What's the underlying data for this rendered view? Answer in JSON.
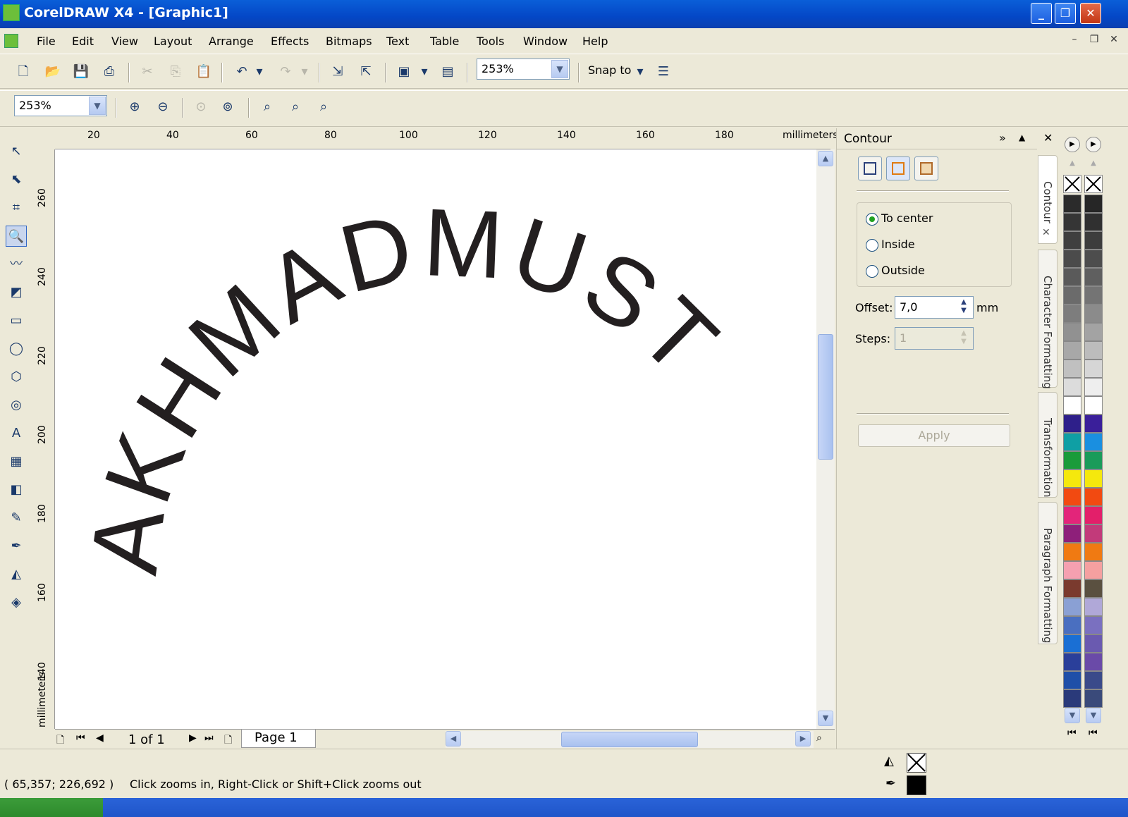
{
  "window": {
    "title": "CorelDRAW X4 - [Graphic1]"
  },
  "menu": [
    "File",
    "Edit",
    "View",
    "Layout",
    "Arrange",
    "Effects",
    "Bitmaps",
    "Text",
    "Table",
    "Tools",
    "Window",
    "Help"
  ],
  "toolbar": {
    "zoom_value": "253%",
    "snap_label": "Snap to"
  },
  "property_bar": {
    "zoom_value": "253%"
  },
  "ruler": {
    "top_labels": [
      "20",
      "40",
      "60",
      "80",
      "100",
      "120",
      "140",
      "160",
      "180"
    ],
    "units": "millimeters",
    "left_labels": [
      "260",
      "240",
      "220",
      "200",
      "180",
      "160",
      "140"
    ],
    "left_units": "millimeters"
  },
  "canvas": {
    "artistic_text": "AKHMADMUST"
  },
  "page_nav": {
    "counter": "1 of 1",
    "page_tab": "Page 1"
  },
  "docker": {
    "title": "Contour",
    "options": [
      {
        "label": "To center",
        "selected": true
      },
      {
        "label": "Inside",
        "selected": false
      },
      {
        "label": "Outside",
        "selected": false
      }
    ],
    "offset_label": "Offset:",
    "offset_value": "7,0",
    "offset_unit": "mm",
    "steps_label": "Steps:",
    "steps_value": "1",
    "apply_label": "Apply"
  },
  "docker_tabs": [
    "Contour",
    "Character Formatting",
    "Transformation",
    "Paragraph Formatting"
  ],
  "palette_colors_1": [
    "#2b2b2b",
    "#353535",
    "#3f3f3f",
    "#4b4b4b",
    "#5a5a5a",
    "#6b6b6b",
    "#7d7d7d",
    "#919191",
    "#a8a8a8",
    "#c0c0c0",
    "#dcdcdc",
    "#ffffff",
    "#2e1f8a",
    "#0f9fa4",
    "#1a9b3a",
    "#f5e80d",
    "#f24a11",
    "#e3257a",
    "#8e1f7a",
    "#f07a12",
    "#f5a0b0",
    "#7a3a2e",
    "#8aa0d4",
    "#4a6fc0",
    "#1a6fd4",
    "#2a3f9a",
    "#1f4fa8",
    "#2a3a7a",
    "#1f2f6a"
  ],
  "palette_colors_2": [
    "#262626",
    "#303030",
    "#3d3d3d",
    "#4d4d4d",
    "#5f5f5f",
    "#747474",
    "#8b8b8b",
    "#a3a3a3",
    "#bcbcbc",
    "#d6d6d6",
    "#eeeeee",
    "#ffffff",
    "#3a1f9a",
    "#1a8fe0",
    "#1a9b5a",
    "#f5e80d",
    "#f24a11",
    "#e31f6a",
    "#c23a7a",
    "#f07a12",
    "#f5a0a0",
    "#5a5040",
    "#b0a8d8",
    "#7a70c0",
    "#6a5ab0",
    "#6a4aa8",
    "#3a4a8a",
    "#3a4a7a",
    "#2a3a6a"
  ],
  "status": {
    "coords": "( 65,357; 226,692 )",
    "hint": "Click zooms in, Right-Click or Shift+Click zooms out"
  }
}
